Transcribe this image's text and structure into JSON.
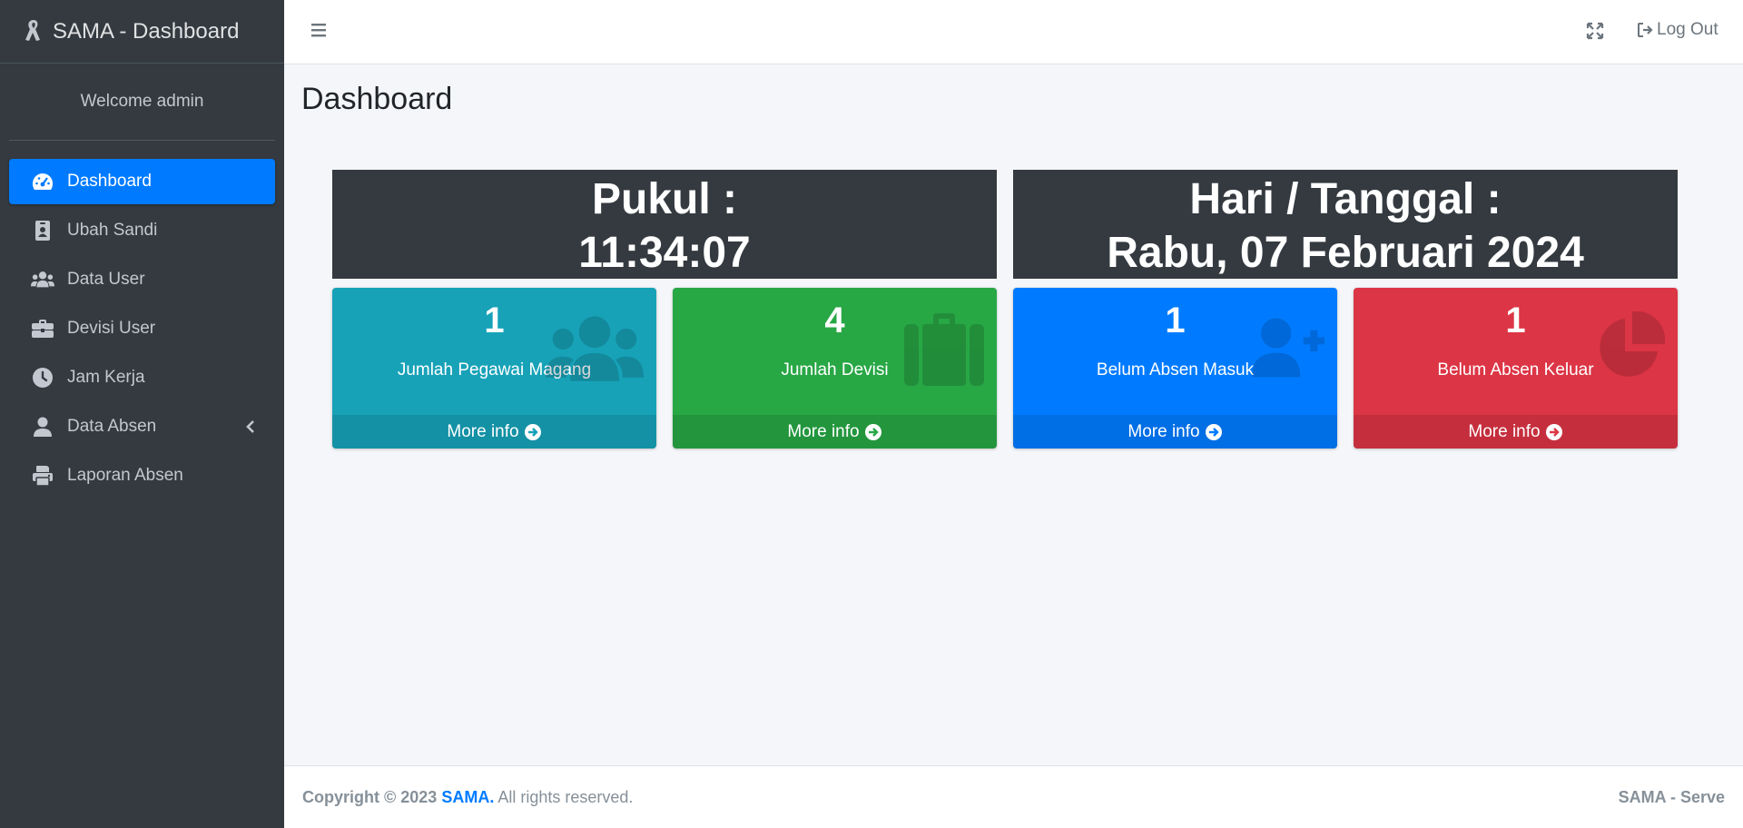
{
  "sidebar": {
    "brand": "SAMA - Dashboard",
    "welcome": "Welcome admin",
    "items": [
      {
        "label": "Dashboard",
        "icon": "tachometer-icon",
        "active": true
      },
      {
        "label": "Ubah Sandi",
        "icon": "id-badge-icon"
      },
      {
        "label": "Data User",
        "icon": "users-icon"
      },
      {
        "label": "Devisi User",
        "icon": "briefcase-icon"
      },
      {
        "label": "Jam Kerja",
        "icon": "clock-icon"
      },
      {
        "label": "Data Absen",
        "icon": "user-icon",
        "has_submenu": true
      },
      {
        "label": "Laporan Absen",
        "icon": "print-icon"
      }
    ]
  },
  "topbar": {
    "menu_icon": "hamburger-icon",
    "fullscreen_icon": "expand-icon",
    "logout_label": "Log Out"
  },
  "main": {
    "page_title": "Dashboard",
    "clock": {
      "label": "Pukul :",
      "time": "11:34:07"
    },
    "date": {
      "label": "Hari / Tanggal :",
      "value": "Rabu, 07 Februari 2024"
    },
    "boxes": [
      {
        "count": "1",
        "label": "Jumlah Pegawai Magang",
        "more": "More info",
        "icon": "users-icon",
        "color": "#17a2b8"
      },
      {
        "count": "4",
        "label": "Jumlah Devisi",
        "more": "More info",
        "icon": "suitcase-icon",
        "color": "#28a745"
      },
      {
        "count": "1",
        "label": "Belum Absen Masuk",
        "more": "More info",
        "icon": "user-plus-icon",
        "color": "#007bff"
      },
      {
        "count": "1",
        "label": "Belum Absen Keluar",
        "more": "More info",
        "icon": "pie-chart-icon",
        "color": "#dc3545"
      }
    ]
  },
  "footer": {
    "copyright_prefix": "Copyright © 2023",
    "brand": "SAMA.",
    "rights": "All rights reserved.",
    "right_text": "SAMA - Serve"
  }
}
